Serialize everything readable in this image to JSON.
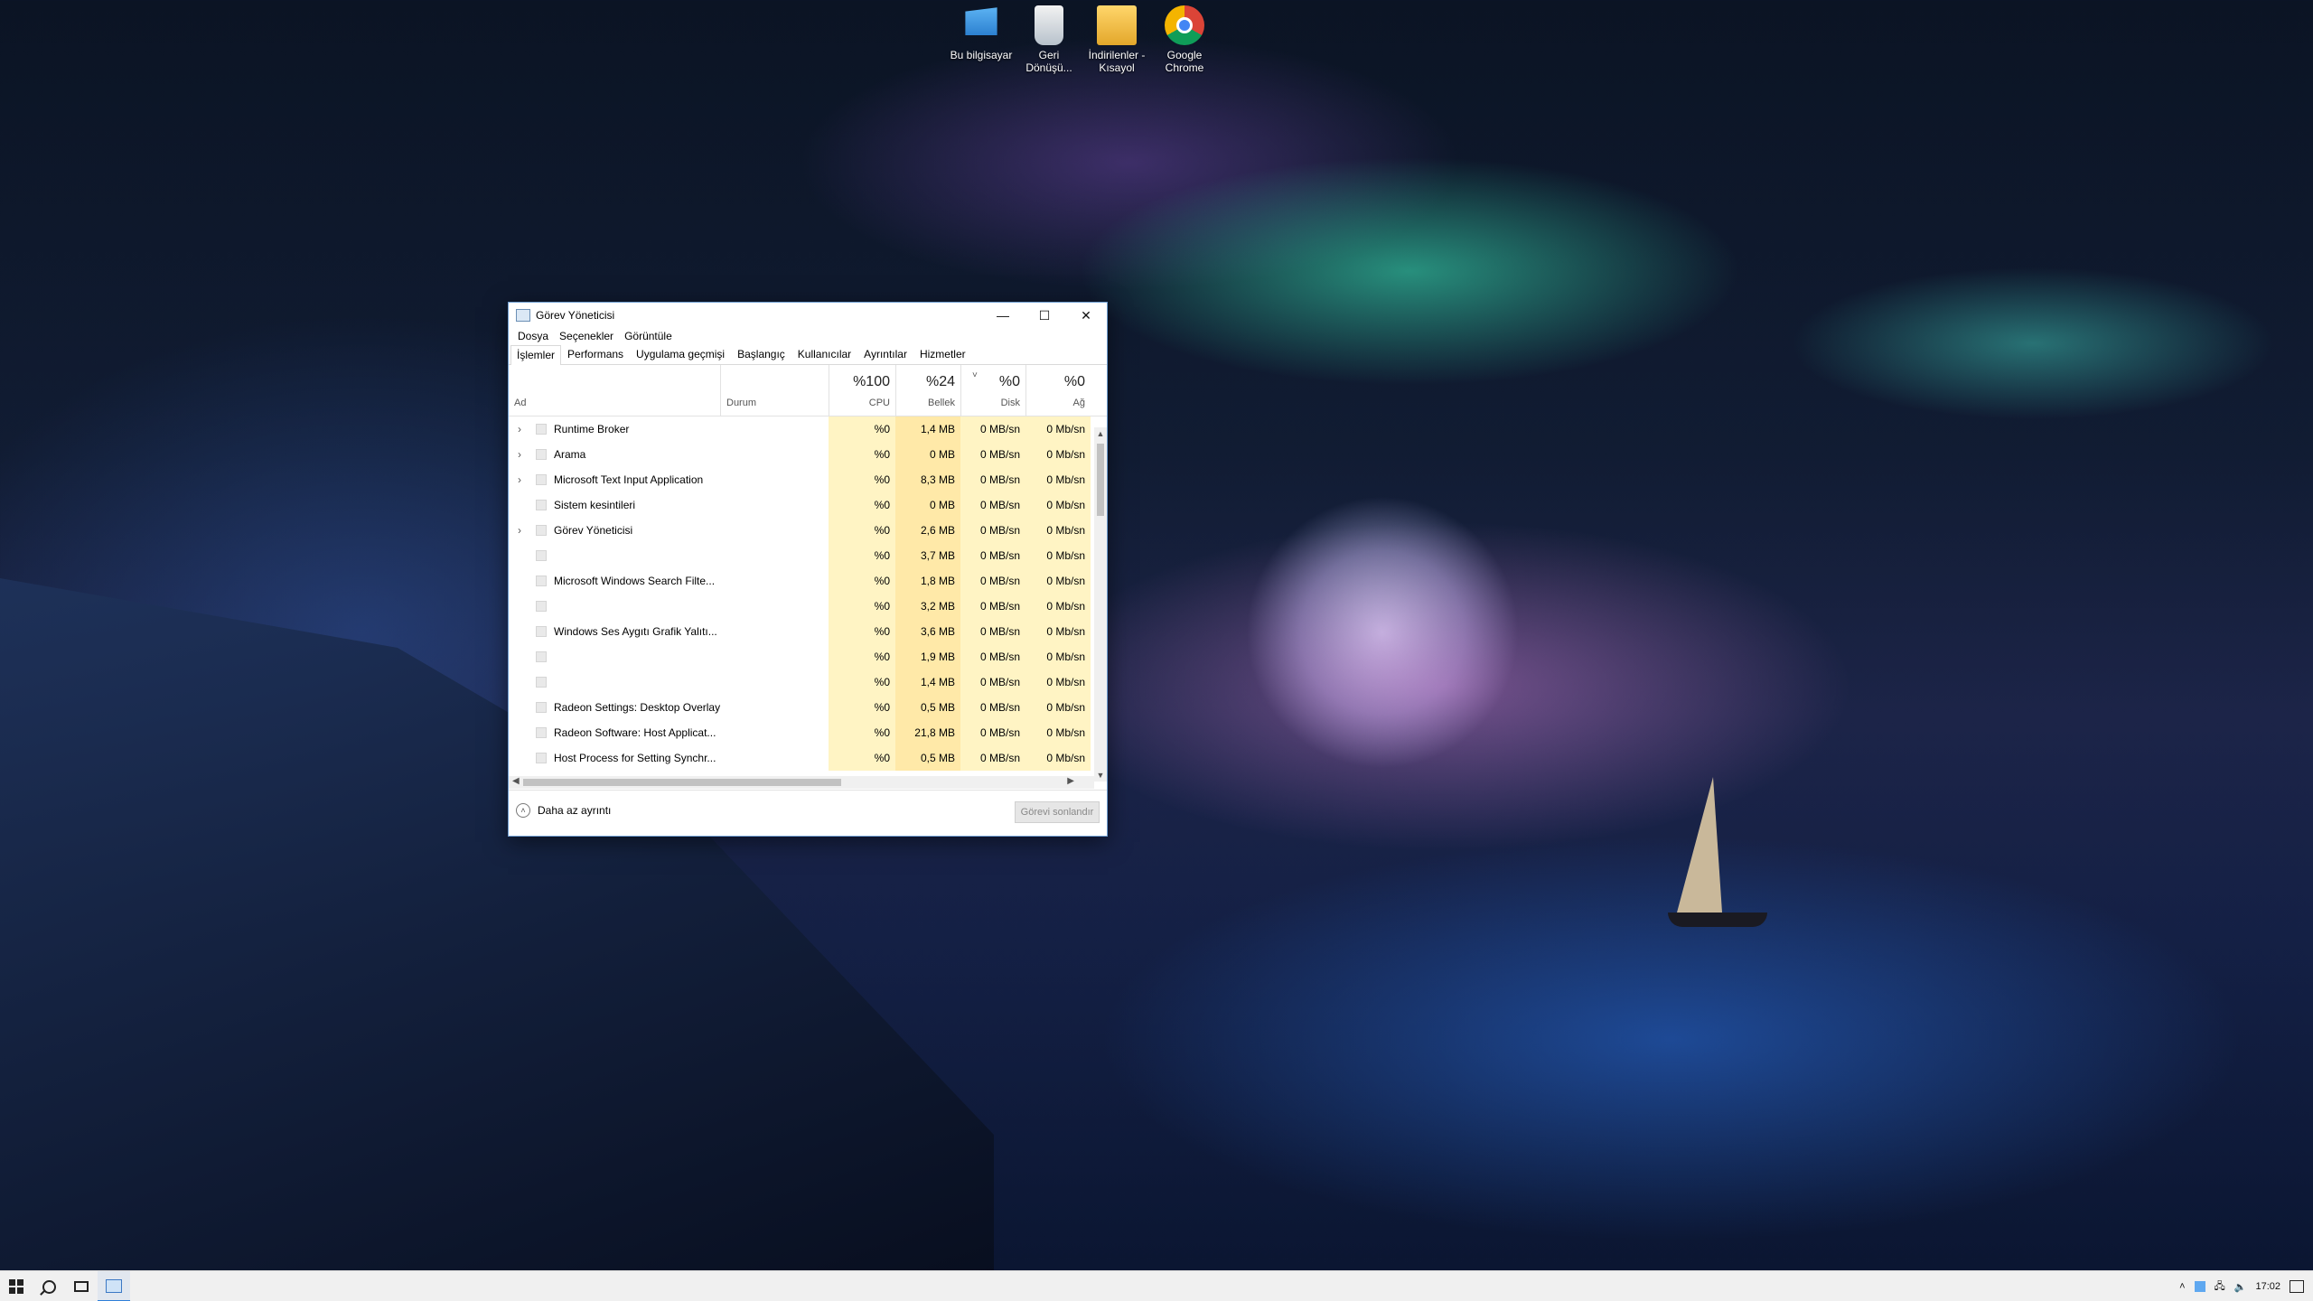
{
  "desktop": {
    "icons": [
      {
        "label": "Bu bilgisayar",
        "icon": "computer-icon"
      },
      {
        "label": "Geri Dönüşü...",
        "icon": "recycle-bin-icon"
      },
      {
        "label": "İndirilenler - Kısayol",
        "icon": "downloads-folder-icon"
      },
      {
        "label": "Google Chrome",
        "icon": "chrome-icon"
      }
    ]
  },
  "window": {
    "title": "Görev Yöneticisi",
    "controls": {
      "minimize": "—",
      "maximize": "☐",
      "close": "✕"
    },
    "menu": [
      "Dosya",
      "Seçenekler",
      "Görüntüle"
    ],
    "tabs": [
      "İşlemler",
      "Performans",
      "Uygulama geçmişi",
      "Başlangıç",
      "Kullanıcılar",
      "Ayrıntılar",
      "Hizmetler"
    ],
    "active_tab": "İşlemler",
    "columns": {
      "name": "Ad",
      "status": "Durum",
      "cpu": {
        "pct": "%100",
        "label": "CPU"
      },
      "memory": {
        "pct": "%24",
        "label": "Bellek"
      },
      "disk": {
        "pct": "%0",
        "label": "Disk"
      },
      "network": {
        "pct": "%0",
        "label": "Ağ"
      }
    },
    "rows": [
      {
        "name": "Runtime Broker",
        "expand": "›",
        "cpu": "%0",
        "memory": "1,4 MB",
        "disk": "0 MB/sn",
        "network": "0 Mb/sn"
      },
      {
        "name": "Arama",
        "expand": "›",
        "cpu": "%0",
        "memory": "0 MB",
        "disk": "0 MB/sn",
        "network": "0 Mb/sn"
      },
      {
        "name": "Microsoft Text Input Application",
        "expand": "›",
        "cpu": "%0",
        "memory": "8,3 MB",
        "disk": "0 MB/sn",
        "network": "0 Mb/sn"
      },
      {
        "name": "Sistem kesintileri",
        "expand": "",
        "cpu": "%0",
        "memory": "0 MB",
        "disk": "0 MB/sn",
        "network": "0 Mb/sn"
      },
      {
        "name": "Görev Yöneticisi",
        "expand": "›",
        "cpu": "%0",
        "memory": "2,6 MB",
        "disk": "0 MB/sn",
        "network": "0 Mb/sn"
      },
      {
        "name": "",
        "expand": "",
        "cpu": "%0",
        "memory": "3,7 MB",
        "disk": "0 MB/sn",
        "network": "0 Mb/sn"
      },
      {
        "name": "Microsoft Windows Search Filte...",
        "expand": "",
        "cpu": "%0",
        "memory": "1,8 MB",
        "disk": "0 MB/sn",
        "network": "0 Mb/sn"
      },
      {
        "name": "",
        "expand": "",
        "cpu": "%0",
        "memory": "3,2 MB",
        "disk": "0 MB/sn",
        "network": "0 Mb/sn"
      },
      {
        "name": "Windows Ses Aygıtı Grafik Yalıtı...",
        "expand": "",
        "cpu": "%0",
        "memory": "3,6 MB",
        "disk": "0 MB/sn",
        "network": "0 Mb/sn"
      },
      {
        "name": "",
        "expand": "",
        "cpu": "%0",
        "memory": "1,9 MB",
        "disk": "0 MB/sn",
        "network": "0 Mb/sn"
      },
      {
        "name": "",
        "expand": "",
        "cpu": "%0",
        "memory": "1,4 MB",
        "disk": "0 MB/sn",
        "network": "0 Mb/sn"
      },
      {
        "name": "Radeon Settings: Desktop Overlay",
        "expand": "",
        "cpu": "%0",
        "memory": "0,5 MB",
        "disk": "0 MB/sn",
        "network": "0 Mb/sn"
      },
      {
        "name": "Radeon Software: Host Applicat...",
        "expand": "",
        "cpu": "%0",
        "memory": "21,8 MB",
        "disk": "0 MB/sn",
        "network": "0 Mb/sn"
      },
      {
        "name": "Host Process for Setting Synchr...",
        "expand": "",
        "cpu": "%0",
        "memory": "0,5 MB",
        "disk": "0 MB/sn",
        "network": "0 Mb/sn"
      }
    ],
    "footer": {
      "less_details": "Daha az ayrıntı",
      "end_task": "Görevi sonlandır"
    }
  },
  "taskbar": {
    "time": "17:02",
    "tray_icons": [
      "chevron-up-icon",
      "tray-app-icon",
      "network-icon",
      "volume-icon"
    ]
  }
}
